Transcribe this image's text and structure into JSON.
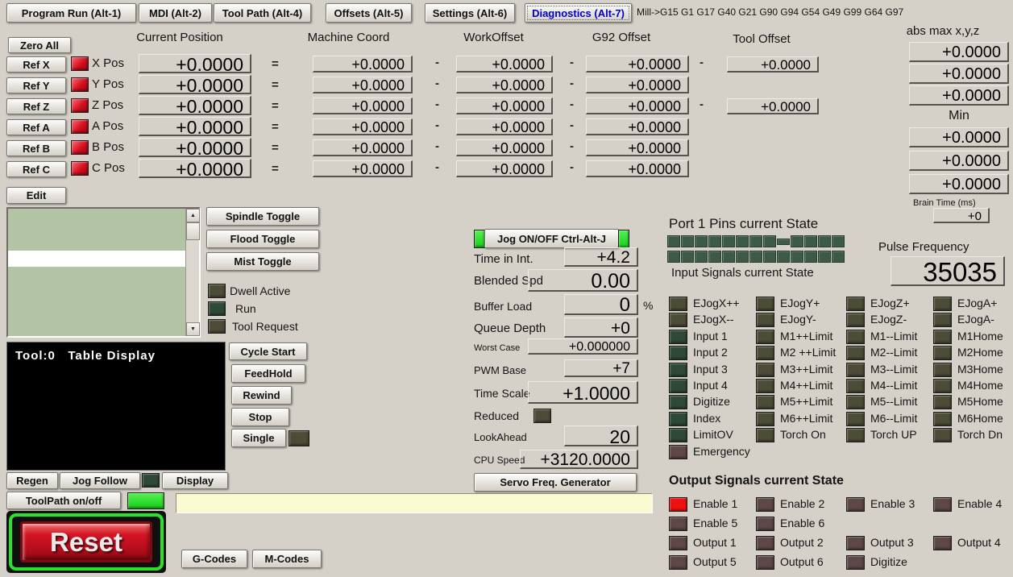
{
  "tabs": [
    "Program Run (Alt-1)",
    "MDI (Alt-2)",
    "Tool Path (Alt-4)",
    "Offsets (Alt-5)",
    "Settings (Alt-6)",
    "Diagnostics (Alt-7)"
  ],
  "status_modes": "Mill->G15  G1 G17 G40 G21 G90 G94 G54 G49 G99 G64 G97",
  "separators": {
    "equals": "=",
    "minus": "-",
    "percent": "%"
  },
  "dro": {
    "headers": {
      "current_position": "Current Position",
      "machine_coord": "Machine Coord",
      "work_offset": "WorkOffset",
      "g92_offset": "G92 Offset",
      "tool_offset": "Tool Offset",
      "abs_max": "abs max x,y,z",
      "min": "Min",
      "brain_time": "Brain Time (ms)"
    },
    "zero_all": "Zero All",
    "rows": [
      {
        "ref": "Ref X",
        "axis": "X Pos",
        "current": "+0.0000",
        "machine": "+0.0000",
        "work": "+0.0000",
        "g92": "+0.0000",
        "tool": "+0.0000"
      },
      {
        "ref": "Ref Y",
        "axis": "Y Pos",
        "current": "+0.0000",
        "machine": "+0.0000",
        "work": "+0.0000",
        "g92": "+0.0000",
        "tool": null
      },
      {
        "ref": "Ref Z",
        "axis": "Z Pos",
        "current": "+0.0000",
        "machine": "+0.0000",
        "work": "+0.0000",
        "g92": "+0.0000",
        "tool": "+0.0000"
      },
      {
        "ref": "Ref A",
        "axis": "A Pos",
        "current": "+0.0000",
        "machine": "+0.0000",
        "work": "+0.0000",
        "g92": "+0.0000",
        "tool": null
      },
      {
        "ref": "Ref B",
        "axis": "B Pos",
        "current": "+0.0000",
        "machine": "+0.0000",
        "work": "+0.0000",
        "g92": "+0.0000",
        "tool": null
      },
      {
        "ref": "Ref C",
        "axis": "C Pos",
        "current": "+0.0000",
        "machine": "+0.0000",
        "work": "+0.0000",
        "g92": "+0.0000",
        "tool": null
      }
    ],
    "abs_max_values": [
      "+0.0000",
      "+0.0000",
      "+0.0000"
    ],
    "min_values": [
      "+0.0000",
      "+0.0000",
      "+0.0000"
    ],
    "brain_time_value": "+0"
  },
  "edit_button": "Edit",
  "toggles": [
    "Spindle Toggle",
    "Flood Toggle",
    "Mist Toggle"
  ],
  "state_leds": [
    {
      "label": "Dwell Active",
      "color": "olive"
    },
    {
      "label": "Run",
      "color": "green"
    },
    {
      "label": "Tool Request",
      "color": "olive"
    }
  ],
  "tool_display": {
    "title": "Tool:0   Table Display"
  },
  "transport": [
    "Cycle Start",
    "FeedHold",
    "Rewind",
    "Stop",
    "Single"
  ],
  "bottom_buttons": {
    "regen": "Regen",
    "jog_follow": "Jog Follow",
    "display": "Display",
    "toolpath": "ToolPath on/off",
    "reset": "Reset",
    "gcodes": "G-Codes",
    "mcodes": "M-Codes"
  },
  "command_field": {
    "value": ""
  },
  "jog_panel": {
    "button": "Jog ON/OFF Ctrl-Alt-J",
    "fields": [
      {
        "label": "Time in Int.",
        "value": "+4.2"
      },
      {
        "label": "Blended Spd",
        "value": "0.00"
      },
      {
        "label": "Buffer Load",
        "value": "0",
        "suffix": "%"
      },
      {
        "label": "Queue Depth",
        "value": "+0"
      },
      {
        "label": "Worst Case",
        "value": "+0.000000"
      },
      {
        "label": "PWM Base",
        "value": "+7"
      },
      {
        "label": "Time Scale",
        "value": "+1.0000"
      },
      {
        "label": "Reduced",
        "led": "olive"
      },
      {
        "label": "LookAhead",
        "value": "20"
      },
      {
        "label": "CPU Speed",
        "value": "+3120.0000"
      }
    ],
    "servo_button": "Servo Freq. Generator"
  },
  "port_pins": {
    "heading": "Port 1 Pins current State",
    "subheading": "Input Signals current State",
    "row1_count": 13,
    "row2_count": 13
  },
  "pulse": {
    "label": "Pulse Frequency",
    "value": "35035"
  },
  "input_signals": {
    "rows": [
      [
        {
          "label": "EJogX++",
          "color": "olive"
        },
        {
          "label": "EJogY+",
          "color": "olive"
        },
        {
          "label": "EJogZ+",
          "color": "olive"
        },
        {
          "label": "EJogA+",
          "color": "olive"
        }
      ],
      [
        {
          "label": "EJogX--",
          "color": "olive"
        },
        {
          "label": "EJogY-",
          "color": "olive"
        },
        {
          "label": "EJogZ-",
          "color": "olive"
        },
        {
          "label": "EJogA-",
          "color": "olive"
        }
      ],
      [
        {
          "label": "Input 1",
          "color": "green"
        },
        {
          "label": "M1++Limit",
          "color": "olive"
        },
        {
          "label": "M1--Limit",
          "color": "olive"
        },
        {
          "label": "M1Home",
          "color": "olive"
        }
      ],
      [
        {
          "label": "Input 2",
          "color": "green"
        },
        {
          "label": "M2 ++Limit",
          "color": "olive"
        },
        {
          "label": "M2--Limit",
          "color": "olive"
        },
        {
          "label": "M2Home",
          "color": "olive"
        }
      ],
      [
        {
          "label": "Input 3",
          "color": "green"
        },
        {
          "label": "M3++Limit",
          "color": "olive"
        },
        {
          "label": "M3--Limit",
          "color": "olive"
        },
        {
          "label": "M3Home",
          "color": "olive"
        }
      ],
      [
        {
          "label": "Input 4",
          "color": "green"
        },
        {
          "label": "M4++Limit",
          "color": "olive"
        },
        {
          "label": "M4--Limit",
          "color": "olive"
        },
        {
          "label": "M4Home",
          "color": "olive"
        }
      ],
      [
        {
          "label": "Digitize",
          "color": "green"
        },
        {
          "label": "M5++Limit",
          "color": "olive"
        },
        {
          "label": "M5--Limit",
          "color": "olive"
        },
        {
          "label": "M5Home",
          "color": "olive"
        }
      ],
      [
        {
          "label": "Index",
          "color": "green"
        },
        {
          "label": "M6++Limit",
          "color": "olive"
        },
        {
          "label": "M6--Limit",
          "color": "olive"
        },
        {
          "label": "M6Home",
          "color": "olive"
        }
      ],
      [
        {
          "label": "LimitOV",
          "color": "green"
        },
        {
          "label": "Torch On",
          "color": "olive"
        },
        {
          "label": "Torch UP",
          "color": "olive"
        },
        {
          "label": "Torch Dn",
          "color": "olive"
        }
      ],
      [
        {
          "label": "Emergency",
          "color": "maroon"
        },
        null,
        null,
        null
      ]
    ]
  },
  "output_signals": {
    "heading": "Output Signals current State",
    "rows": [
      [
        {
          "label": "Enable 1",
          "color": "enable-red"
        },
        {
          "label": "Enable 2",
          "color": "maroon"
        },
        {
          "label": "Enable 3",
          "color": "maroon"
        },
        {
          "label": "Enable 4",
          "color": "maroon"
        }
      ],
      [
        {
          "label": "Enable 5",
          "color": "maroon"
        },
        {
          "label": "Enable 6",
          "color": "maroon"
        },
        null,
        null
      ],
      [
        {
          "label": "Output 1",
          "color": "maroon"
        },
        {
          "label": "Output 2",
          "color": "maroon"
        },
        {
          "label": "Output 3",
          "color": "maroon"
        },
        {
          "label": "Output 4",
          "color": "maroon"
        }
      ],
      [
        {
          "label": "Output 5",
          "color": "maroon"
        },
        {
          "label": "Output 6",
          "color": "maroon"
        },
        {
          "label": "Digitize",
          "color": "maroon"
        },
        null
      ]
    ]
  },
  "colors": {
    "background": "#d5d1c9",
    "active_tab_text": "#0000cd",
    "led_red": "#d50f1f",
    "led_olive": "#4c4c37",
    "led_green": "#2f4938",
    "led_maroon": "#5d4747",
    "led_bright_green": "#2be22b",
    "enable1_red": "#ef1111",
    "port_pin_green": "#3d5a49",
    "listbox_green": "#b3c4a5",
    "command_field_yellow": "#fafad0",
    "reset_red": "#c41020"
  }
}
